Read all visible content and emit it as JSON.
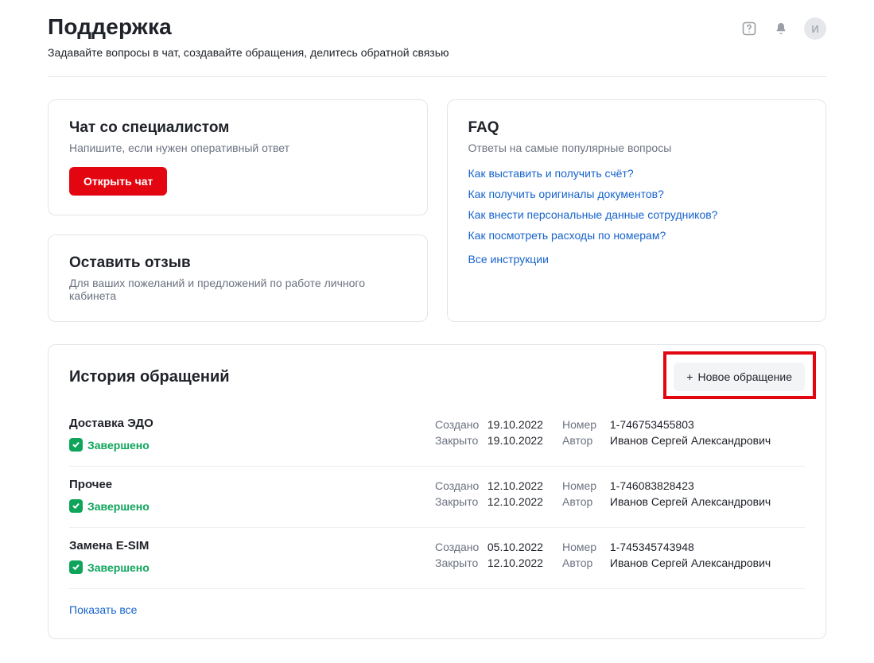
{
  "header": {
    "title": "Поддержка",
    "subtitle": "Задавайте вопросы в чат, создавайте обращения, делитесь обратной связью",
    "avatar_initial": "И"
  },
  "chat_card": {
    "title": "Чат со специалистом",
    "subtitle": "Напишите, если нужен оперативный ответ",
    "button": "Открыть чат"
  },
  "feedback_card": {
    "title": "Оставить отзыв",
    "subtitle": "Для ваших пожеланий и предложений по работе личного кабинета"
  },
  "faq_card": {
    "title": "FAQ",
    "subtitle": "Ответы на самые популярные вопросы",
    "links": [
      "Как выставить и получить счёт?",
      "Как получить оригиналы документов?",
      "Как внести персональные данные сотрудников?",
      "Как посмотреть расходы по номерам?"
    ],
    "all": "Все инструкции"
  },
  "history": {
    "title": "История обращений",
    "new_button": "Новое обращение",
    "labels": {
      "created": "Создано",
      "closed": "Закрыто",
      "number": "Номер",
      "author": "Автор"
    },
    "tickets": [
      {
        "title": "Доставка ЭДО",
        "status": "Завершено",
        "created": "19.10.2022",
        "closed": "19.10.2022",
        "number": "1-746753455803",
        "author": "Иванов Сергей Александрович"
      },
      {
        "title": "Прочее",
        "status": "Завершено",
        "created": "12.10.2022",
        "closed": "12.10.2022",
        "number": "1-746083828423",
        "author": "Иванов Сергей Александрович"
      },
      {
        "title": "Замена E-SIM",
        "status": "Завершено",
        "created": "05.10.2022",
        "closed": "12.10.2022",
        "number": "1-745345743948",
        "author": "Иванов Сергей Александрович"
      }
    ],
    "show_all": "Показать все"
  }
}
